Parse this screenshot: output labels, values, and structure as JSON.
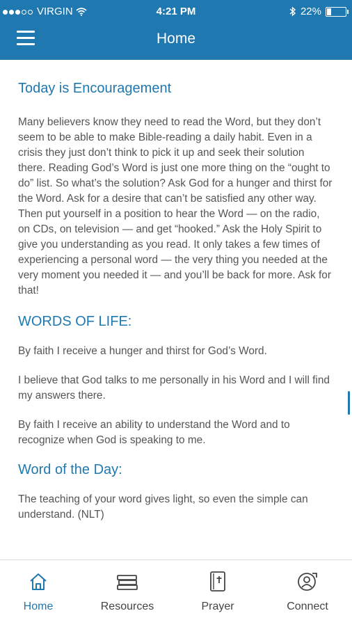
{
  "status": {
    "carrier": "VIRGIN",
    "time": "4:21 PM",
    "battery": "22%",
    "battery_level": 0.22
  },
  "header": {
    "title": "Home"
  },
  "devotion": {
    "title": "Today is Encouragement",
    "body": "Many believers know they need to read the Word, but they don’t seem to be able to make Bible-reading a daily habit. Even in a crisis they just don’t think to pick it up and seek their solution there. Reading God’s Word is just one more thing on the “ought to do” list. So what’s the solution? Ask God for a hunger and thirst for the Word. Ask for a desire that can’t be satisfied any other way. Then put yourself in a position to hear the Word — on the radio, on CDs, on television — and get “hooked.” Ask the Holy Spirit to give you understanding as you read. It only takes a few times of experiencing a personal word — the very thing you needed at the very moment you needed it — and you’ll be back for more. Ask for that!"
  },
  "words_of_life": {
    "heading": "WORDS OF LIFE:",
    "items": [
      "By faith I receive a hunger and thirst for God’s Word.",
      "I believe that God talks to me personally in his Word and I will find my answers there.",
      "By faith I receive an ability to understand the Word and to recognize when God is speaking to me."
    ]
  },
  "word_of_day": {
    "heading": "Word of the Day:",
    "text": "The teaching of your word gives light, so even the simple can understand. (NLT)"
  },
  "tabs": [
    {
      "label": "Home",
      "icon": "home-icon",
      "active": true
    },
    {
      "label": "Resources",
      "icon": "books-icon",
      "active": false
    },
    {
      "label": "Prayer",
      "icon": "bible-icon",
      "active": false
    },
    {
      "label": "Connect",
      "icon": "connect-icon",
      "active": false
    }
  ],
  "colors": {
    "primary": "#1f78b0",
    "text": "#555555"
  }
}
